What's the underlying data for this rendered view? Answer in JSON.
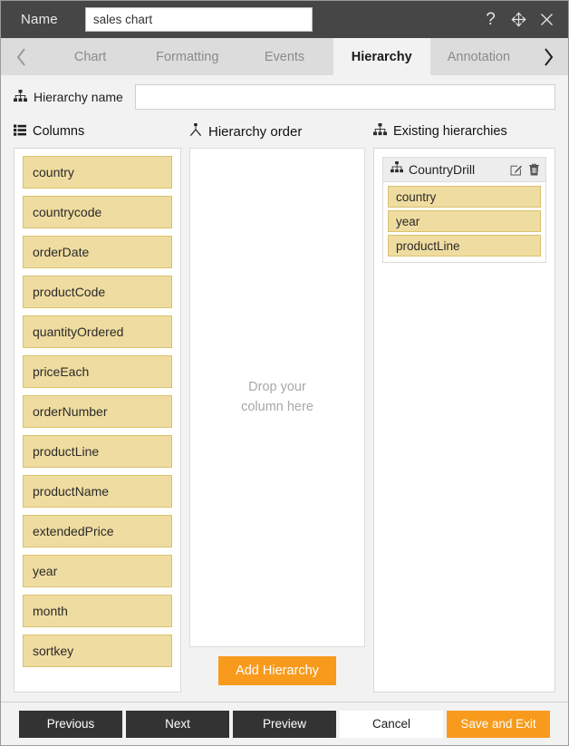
{
  "titlebar": {
    "name_label": "Name",
    "name_value": "sales chart",
    "help_icon": "question-mark-icon",
    "move_icon": "move-arrows-icon",
    "close_icon": "close-icon"
  },
  "tabstrip": {
    "prev_icon": "chevron-left-icon",
    "next_icon": "chevron-right-icon",
    "tabs": [
      {
        "label": "Chart",
        "active": false
      },
      {
        "label": "Formatting",
        "active": false
      },
      {
        "label": "Events",
        "active": false
      },
      {
        "label": "Hierarchy",
        "active": true
      },
      {
        "label": "Annotation",
        "active": false
      }
    ]
  },
  "hierarchy_name": {
    "icon": "sitemap-icon",
    "label": "Hierarchy name",
    "value": "",
    "placeholder": ""
  },
  "columns_panel": {
    "icon": "list-icon",
    "title": "Columns",
    "items": [
      "country",
      "countrycode",
      "orderDate",
      "productCode",
      "quantityOrdered",
      "priceEach",
      "orderNumber",
      "productLine",
      "productName",
      "extendedPrice",
      "year",
      "month",
      "sortkey"
    ]
  },
  "hierarchy_order_panel": {
    "icon": "hierarchy-node-icon",
    "title": "Hierarchy order",
    "dropzone_line1": "Drop your",
    "dropzone_line2": "column here",
    "add_button": "Add Hierarchy"
  },
  "existing_panel": {
    "icon": "sitemap-icon",
    "title": "Existing hierarchies",
    "hierarchies": [
      {
        "icon": "sitemap-icon",
        "name": "CountryDrill",
        "edit_icon": "edit-pencil-icon",
        "delete_icon": "trash-icon",
        "items": [
          "country",
          "year",
          "productLine"
        ]
      }
    ]
  },
  "footer": {
    "buttons": [
      {
        "label": "Previous",
        "style": "dark"
      },
      {
        "label": "Next",
        "style": "dark"
      },
      {
        "label": "Preview",
        "style": "dark"
      },
      {
        "label": "Cancel",
        "style": "light"
      },
      {
        "label": "Save and Exit",
        "style": "accent"
      }
    ]
  },
  "colors": {
    "titlebar_bg": "#464646",
    "tabstrip_bg": "#dcdcdc",
    "active_tab_bg": "#f2f2f2",
    "chip_bg": "#efdca0",
    "chip_border": "#d9c26d",
    "accent": "#f89a1c",
    "dark_button": "#333333",
    "body_bg": "#f2f2f2"
  }
}
